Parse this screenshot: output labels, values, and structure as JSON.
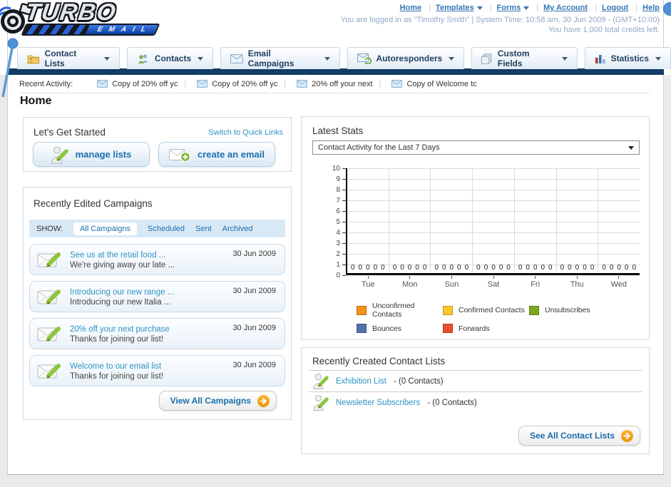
{
  "brand": {
    "title": "TURBO",
    "subtitle": "EMAIL"
  },
  "top_nav": {
    "items": [
      {
        "label": "Home",
        "dropdown": false
      },
      {
        "label": "Templates",
        "dropdown": true
      },
      {
        "label": "Forms",
        "dropdown": true
      },
      {
        "label": "My Account",
        "dropdown": false
      },
      {
        "label": "Logout",
        "dropdown": false
      },
      {
        "label": "Help",
        "dropdown": false
      }
    ],
    "session_line1": "You are logged in as \"Timothy Smith\" | System Time: 10:58 am, 30 Jun 2009 - (GMT+10:00)",
    "session_line2": "You have 1,000 total credits left."
  },
  "main_tabs": [
    {
      "label": "Contact Lists"
    },
    {
      "label": "Contacts"
    },
    {
      "label": "Email Campaigns"
    },
    {
      "label": "Autoresponders"
    },
    {
      "label": "Custom Fields"
    },
    {
      "label": "Statistics"
    }
  ],
  "recent_activity": {
    "label": "Recent Activity:",
    "items": [
      "Copy of 20% off yc",
      "Copy of 20% off yc",
      "20% off your next",
      "Copy of Welcome tc"
    ]
  },
  "page_title": "Home",
  "get_started": {
    "title": "Let's Get Started",
    "switch_link": "Switch to Quick Links",
    "manage_lists_label": "manage lists",
    "create_email_label": "create an email"
  },
  "campaigns": {
    "title": "Recently Edited Campaigns",
    "show_label": "SHOW:",
    "filters": [
      {
        "label": "All Campaigns",
        "active": true
      },
      {
        "label": "Scheduled",
        "active": false
      },
      {
        "label": "Sent",
        "active": false
      },
      {
        "label": "Archived",
        "active": false
      }
    ],
    "items": [
      {
        "title": "See us at the retail food ...",
        "subtitle": "We're giving away our late ...",
        "date": "30 Jun 2009"
      },
      {
        "title": "Introducing our new range ...",
        "subtitle": "Introducing our new Italia ...",
        "date": "30 Jun 2009"
      },
      {
        "title": "20% off your next purchase",
        "subtitle": "Thanks for joining our list!",
        "date": "30 Jun 2009"
      },
      {
        "title": "Welcome to our email list",
        "subtitle": "Thanks for joining our list!",
        "date": "30 Jun 2009"
      }
    ],
    "view_all_label": "View All Campaigns"
  },
  "stats": {
    "title": "Latest Stats",
    "dropdown_value": "Contact Activity for the Last 7 Days"
  },
  "chart_data": {
    "type": "bar",
    "title": "Contact Activity for the Last 7 Days",
    "categories": [
      "Tue",
      "Mon",
      "Sun",
      "Sat",
      "Fri",
      "Thu",
      "Wed"
    ],
    "series": [
      {
        "name": "Unconfirmed Contacts",
        "color": "#F5921E",
        "values": [
          0,
          0,
          0,
          0,
          0,
          0,
          0
        ]
      },
      {
        "name": "Confirmed Contacts",
        "color": "#FBC92B",
        "values": [
          0,
          0,
          0,
          0,
          0,
          0,
          0
        ]
      },
      {
        "name": "Unsubscribes",
        "color": "#7DA921",
        "values": [
          0,
          0,
          0,
          0,
          0,
          0,
          0
        ]
      },
      {
        "name": "Bounces",
        "color": "#5571AD",
        "values": [
          0,
          0,
          0,
          0,
          0,
          0,
          0
        ]
      },
      {
        "name": "Forwards",
        "color": "#E8512B",
        "values": [
          0,
          0,
          0,
          0,
          0,
          0,
          0
        ]
      }
    ],
    "ylim": [
      0,
      10
    ],
    "yticks": [
      0,
      1,
      2,
      3,
      4,
      5,
      6,
      7,
      8,
      9,
      10
    ],
    "grid": true,
    "legend_position": "bottom",
    "value_labels_shown": true
  },
  "contact_lists": {
    "title": "Recently Created Contact Lists",
    "items": [
      {
        "name": "Exhibition List",
        "detail": "- (0 Contacts)"
      },
      {
        "name": "Newsletter Subscribers",
        "detail": "- (0 Contacts)"
      }
    ],
    "see_all_label": "See All Contact Lists"
  }
}
